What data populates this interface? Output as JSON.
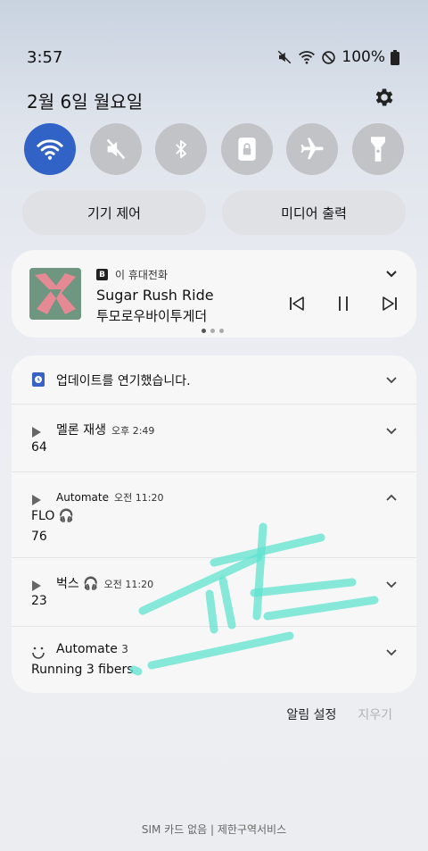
{
  "status": {
    "time": "3:57",
    "battery": "100%"
  },
  "header": {
    "date": "2월 6일 월요일"
  },
  "quick_settings": [
    {
      "name": "wifi",
      "active": true
    },
    {
      "name": "mute",
      "active": false
    },
    {
      "name": "bluetooth",
      "active": false
    },
    {
      "name": "rotation-lock",
      "active": false
    },
    {
      "name": "airplane",
      "active": false
    },
    {
      "name": "flashlight",
      "active": false
    }
  ],
  "pills": {
    "device_control": "기기 제어",
    "media_output": "미디어 출력"
  },
  "media": {
    "source": "이 휴대전화",
    "title": "Sugar Rush Ride",
    "artist": "투모로우바이투게더",
    "app_badge": "B"
  },
  "notifications": {
    "update": {
      "text": "업데이트를 연기했습니다."
    },
    "melon": {
      "app": "멜론 재생",
      "time": "오후 2:49",
      "body": "64"
    },
    "automate1": {
      "app": "Automate",
      "time": "오전 11:20",
      "title": "FLO 🎧",
      "body": "76"
    },
    "bugs": {
      "app": "벅스 🎧",
      "time": "오전 11:20",
      "body": "23"
    },
    "automate2": {
      "app": "Automate",
      "count": "3",
      "body": "Running 3 fibers"
    }
  },
  "actions": {
    "settings": "알림 설정",
    "clear": "지우기"
  },
  "footer": {
    "text": "SIM 카드 없음 | 제한구역서비스"
  },
  "colors": {
    "accent": "#3163c7",
    "scribble": "#5fe3cf"
  }
}
